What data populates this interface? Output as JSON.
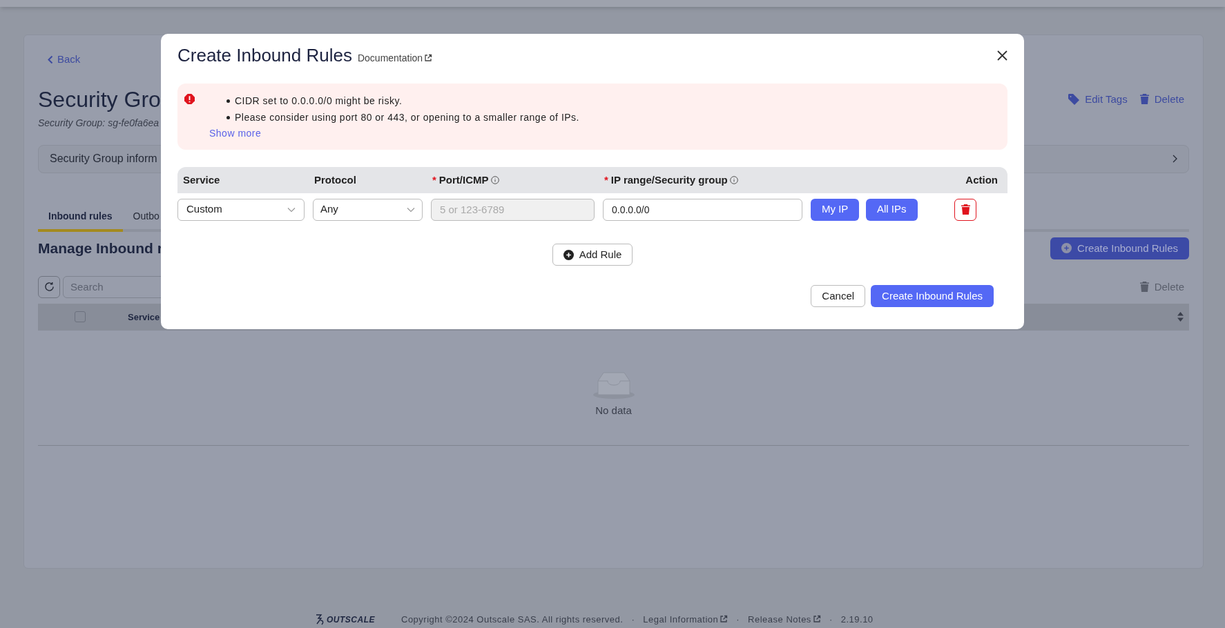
{
  "page": {
    "back": "Back",
    "title": "Security Gro",
    "subtitle": "Security Group: sg-fe0fa6ea",
    "header_actions": [
      {
        "kind": "tag",
        "label": "Edit Tags"
      },
      {
        "kind": "delete",
        "label": "Delete"
      }
    ],
    "info_panel": "Security Group inform",
    "tabs": [
      {
        "label": "Inbound rules",
        "selected": true
      },
      {
        "label": "Outbo",
        "selected": false
      }
    ],
    "section_title": "Manage Inbound r",
    "create_button": "Create Inbound Rules",
    "search": {
      "placeholder": "Search"
    },
    "delete_button": {
      "label": "Delete",
      "disabled": true
    },
    "table": {
      "select_all": {
        "checked": false
      },
      "columns": [
        "Service"
      ],
      "empty": "No data"
    }
  },
  "modal": {
    "title": "Create Inbound Rules",
    "documentation_link": "Documentation",
    "warning": {
      "messages": [
        "CIDR set to 0.0.0.0/0 might be risky.",
        "Please consider using port 80 or 443, or opening to a smaller range of IPs."
      ],
      "show_more": "Show more"
    },
    "columns": [
      {
        "label": "Service",
        "required": false,
        "info": false
      },
      {
        "label": "Protocol",
        "required": false,
        "info": false
      },
      {
        "label": "Port/ICMP",
        "required": true,
        "info": true
      },
      {
        "label": "IP range/Security group",
        "required": true,
        "info": true
      },
      {
        "label": "Action",
        "required": false,
        "info": false
      }
    ],
    "rules": [
      {
        "service": "Custom",
        "protocol": "Any",
        "port": {
          "placeholder": "5 or 123-6789",
          "disabled": true
        },
        "ip_range": "0.0.0.0/0",
        "buttons": [
          "My IP",
          "All IPs"
        ]
      }
    ],
    "required_mark": "*",
    "add_rule": "Add Rule",
    "cancel": "Cancel",
    "submit": "Create Inbound Rules"
  },
  "footer": {
    "logo": "OUTSCALE",
    "copyright": "Copyright ©2024 Outscale SAS. All rights reserved.",
    "separator": "·",
    "links": [
      {
        "label": "Legal Information",
        "external": true
      },
      {
        "label": "Release Notes",
        "external": true
      }
    ],
    "version": "2.19.10"
  }
}
